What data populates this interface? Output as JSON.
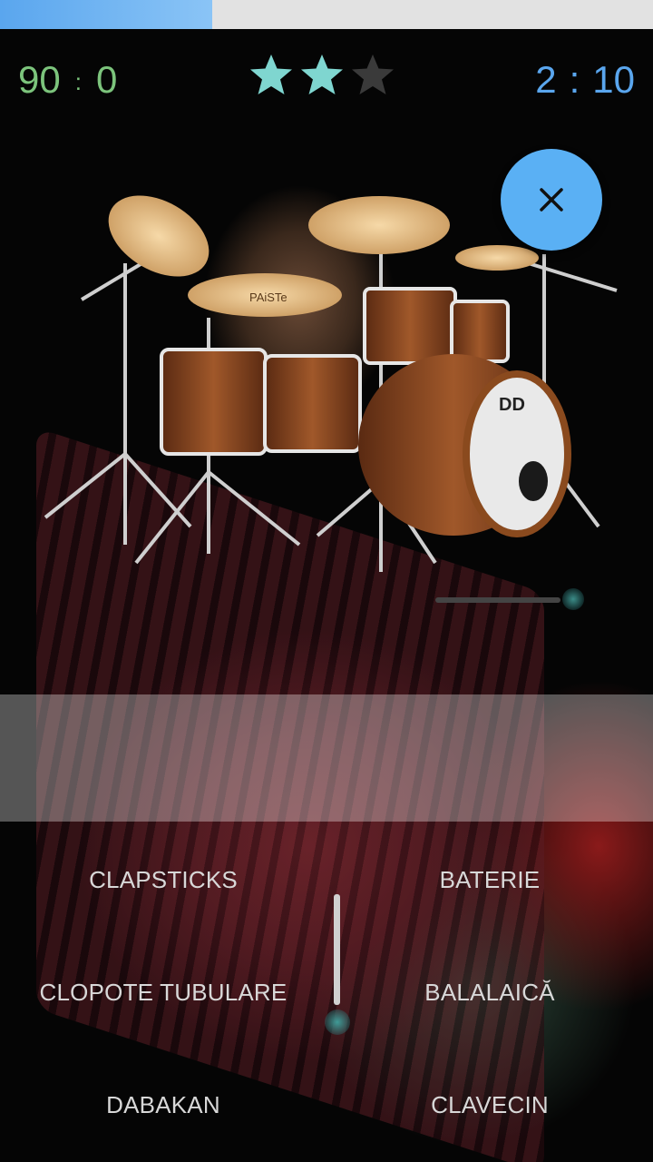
{
  "progress": {
    "fraction": 0.325,
    "color": "#5aa6ee"
  },
  "score": {
    "left_value": "90",
    "separator": ":",
    "right_value": "0",
    "color": "#7cc47c"
  },
  "stars": {
    "filled": 2,
    "total": 3,
    "filled_color": "#7fd6d0",
    "empty_color": "#3a3a3a"
  },
  "timer": {
    "minutes": "2",
    "separator": ":",
    "seconds": "10",
    "color": "#5aa6ee"
  },
  "close_button": {
    "icon": "close-icon",
    "color": "#5ab0f4"
  },
  "drum_image": {
    "logo_text": "PAiSTe",
    "bass_logo": "DD"
  },
  "answers": [
    {
      "label": "CLAPSTICKS"
    },
    {
      "label": "BATERIE"
    },
    {
      "label": "CLOPOTE TUBULARE"
    },
    {
      "label": "BALALAICĂ"
    },
    {
      "label": "DABAKAN"
    },
    {
      "label": "CLAVECIN"
    }
  ]
}
